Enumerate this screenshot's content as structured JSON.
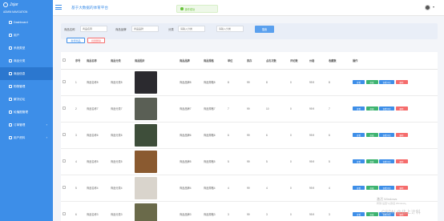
{
  "brand": {
    "logo_text": "Jsjar",
    "subtitle": "ADMIN NAVIGATION"
  },
  "nav": [
    {
      "label": "Dashboard"
    },
    {
      "label": "用户"
    },
    {
      "label": "系统类型"
    },
    {
      "label": "商品分类"
    },
    {
      "label": "商品信息"
    },
    {
      "label": "购物管理"
    },
    {
      "label": "解决论坛"
    },
    {
      "label": "轮播图管理"
    },
    {
      "label": "订单管理",
      "arrow": "›"
    },
    {
      "label": "用户资料",
      "arrow": "›"
    }
  ],
  "header": {
    "title": "基于大数据的体育平台",
    "toast": "操作成功",
    "caret": "▾"
  },
  "search": {
    "name_label": "商品名称",
    "name_placeholder": "商品名称",
    "brand_label": "商品品牌",
    "brand_placeholder": "商品品牌",
    "category_label": "分类",
    "category_placeholder": "请输入分类",
    "date_placeholder": "请输入分类",
    "search_button": "搜索"
  },
  "actions": {
    "add": "新增商品",
    "delete": "批量删除"
  },
  "table": {
    "headers": [
      "",
      "序号",
      "商品名称",
      "商品分类",
      "商品图片",
      "",
      "商品品牌",
      "商品规格",
      "单位",
      "库存",
      "点击次数",
      "评论数",
      "价格",
      "收藏数",
      "操作"
    ],
    "rows": [
      {
        "idx": "1",
        "name": "商品名称8",
        "cat": "商品分类8",
        "brand": "商品品牌8",
        "spec": "商品规格8",
        "unit": "8",
        "stock": "99",
        "clicks": "8",
        "comments": "0",
        "price": "99.9",
        "fav": "8",
        "thumb_color": "#2b2a2f"
      },
      {
        "idx": "2",
        "name": "商品名称7",
        "cat": "商品分类7",
        "brand": "商品品牌7",
        "spec": "商品规格7",
        "unit": "7",
        "stock": "99",
        "clicks": "10",
        "comments": "0",
        "price": "99.9",
        "fav": "7",
        "thumb_color": "#5a5f55"
      },
      {
        "idx": "3",
        "name": "商品名称6",
        "cat": "商品分类6",
        "brand": "商品品牌6",
        "spec": "商品规格6",
        "unit": "6",
        "stock": "99",
        "clicks": "6",
        "comments": "0",
        "price": "99.9",
        "fav": "6",
        "thumb_color": "#3e4e3a"
      },
      {
        "idx": "4",
        "name": "商品名称5",
        "cat": "商品分类5",
        "brand": "商品品牌5",
        "spec": "商品规格5",
        "unit": "5",
        "stock": "99",
        "clicks": "5",
        "comments": "0",
        "price": "99.9",
        "fav": "5",
        "thumb_color": "#8a5a30"
      },
      {
        "idx": "5",
        "name": "商品名称4",
        "cat": "商品分类4",
        "brand": "商品品牌4",
        "spec": "商品规格4",
        "unit": "4",
        "stock": "99",
        "clicks": "4",
        "comments": "0",
        "price": "99.9",
        "fav": "4",
        "thumb_color": "#d9d4cc"
      },
      {
        "idx": "6",
        "name": "商品名称3",
        "cat": "商品分类3",
        "brand": "商品品牌3",
        "spec": "商品规格3",
        "unit": "3",
        "stock": "99",
        "clicks": "3",
        "comments": "0",
        "price": "99.9",
        "fav": "3",
        "thumb_color": "#6a6a4a"
      }
    ],
    "ops": {
      "view": "查看",
      "edit": "修改",
      "review": "查看评论",
      "delete": "删除"
    }
  },
  "watermark": {
    "line1": "激活 Windows",
    "line2": "转到“设置”以激活 Windows。",
    "csdn": "CSDN @北上计科"
  }
}
